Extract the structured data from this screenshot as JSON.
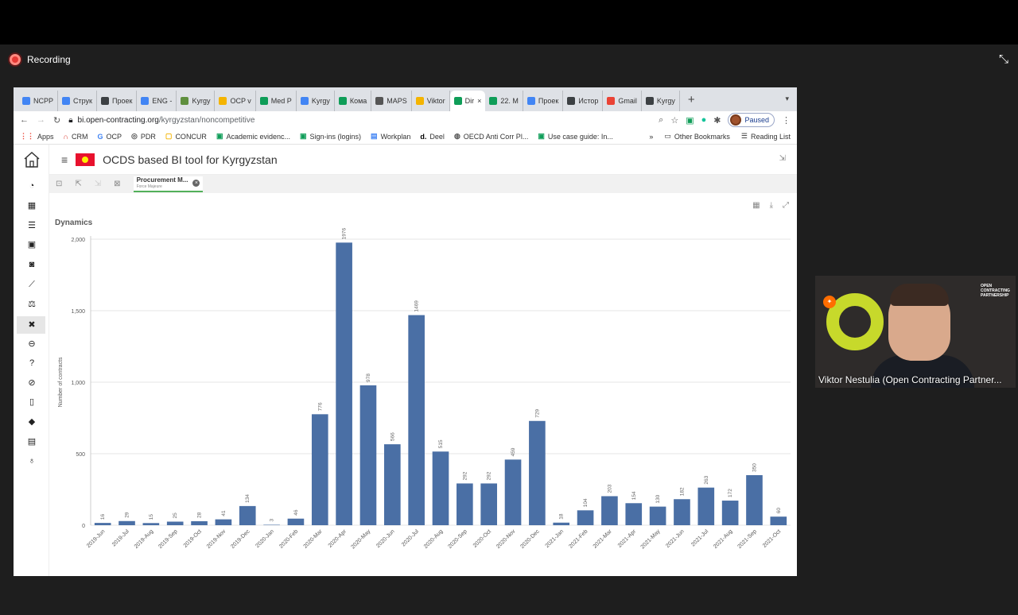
{
  "meeting": {
    "recording_label": "Recording",
    "participant_name": "Viktor Nestulia (Open Contracting Partner..."
  },
  "browser": {
    "tabs": [
      {
        "label": "NCPP",
        "color": "#4285f4"
      },
      {
        "label": "Струк",
        "color": "#4285f4"
      },
      {
        "label": "Проек",
        "color": "#3c4043"
      },
      {
        "label": "ENG -",
        "color": "#4285f4"
      },
      {
        "label": "Kyrgy",
        "color": "#5f8f3e"
      },
      {
        "label": "OCP v",
        "color": "#f4b400"
      },
      {
        "label": "Med P",
        "color": "#0f9d58"
      },
      {
        "label": "Kyrgy",
        "color": "#4285f4"
      },
      {
        "label": "Кома",
        "color": "#0f9d58"
      },
      {
        "label": "MAPS",
        "color": "#555555"
      },
      {
        "label": "Viktor",
        "color": "#f4b400"
      },
      {
        "label": "Dir",
        "color": "#0f9d58",
        "active": true
      },
      {
        "label": "22. M",
        "color": "#0f9d58"
      },
      {
        "label": "Проек",
        "color": "#4285f4"
      },
      {
        "label": "Истор",
        "color": "#3c4043"
      },
      {
        "label": "Gmail",
        "color": "#ea4335"
      },
      {
        "label": "Kyrgy",
        "color": "#3c4043"
      }
    ],
    "url_host": "bi.open-contracting.org",
    "url_path": "/kyrgyzstan/noncompetitive",
    "paused_label": "Paused",
    "bookmarks": [
      "Apps",
      "CRM",
      "OCP",
      "PDR",
      "CONCUR",
      "Academic evidenc...",
      "Sign-ins (logins)",
      "Workplan",
      "Deel",
      "OECD Anti Corr Pl...",
      "Use case guide: In..."
    ],
    "bookmarks_more": "»",
    "other_bookmarks": "Other Bookmarks",
    "reading_list": "Reading List"
  },
  "app": {
    "title": "OCDS based BI tool for Kyrgyzstan",
    "selection_chip_title": "Procurement M...",
    "selection_chip_sub": "Force Majeure"
  },
  "chart_data": {
    "type": "bar",
    "title": "Dynamics",
    "xlabel": "",
    "ylabel": "Number of contracts",
    "ylim": [
      0,
      2000
    ],
    "yticks": [
      "0",
      "500",
      "1,000",
      "1,500",
      "2,000"
    ],
    "grid": true,
    "bar_color": "#4a6fa5",
    "categories": [
      "2019-Jun",
      "2019-Jul",
      "2019-Aug",
      "2019-Sep",
      "2019-Oct",
      "2019-Nov",
      "2019-Dec",
      "2020-Jan",
      "2020-Feb",
      "2020-Mar",
      "2020-Apr",
      "2020-May",
      "2020-Jun",
      "2020-Jul",
      "2020-Aug",
      "2020-Sep",
      "2020-Oct",
      "2020-Nov",
      "2020-Dec",
      "2021-Jan",
      "2021-Feb",
      "2021-Mar",
      "2021-Apr",
      "2021-May",
      "2021-Jun",
      "2021-Jul",
      "2021-Aug",
      "2021-Sep",
      "2021-Oct"
    ],
    "values": [
      16,
      29,
      15,
      25,
      28,
      41,
      134,
      3,
      46,
      776,
      1976,
      978,
      566,
      1469,
      515,
      292,
      292,
      459,
      729,
      18,
      104,
      203,
      154,
      130,
      182,
      263,
      172,
      350,
      60
    ]
  }
}
